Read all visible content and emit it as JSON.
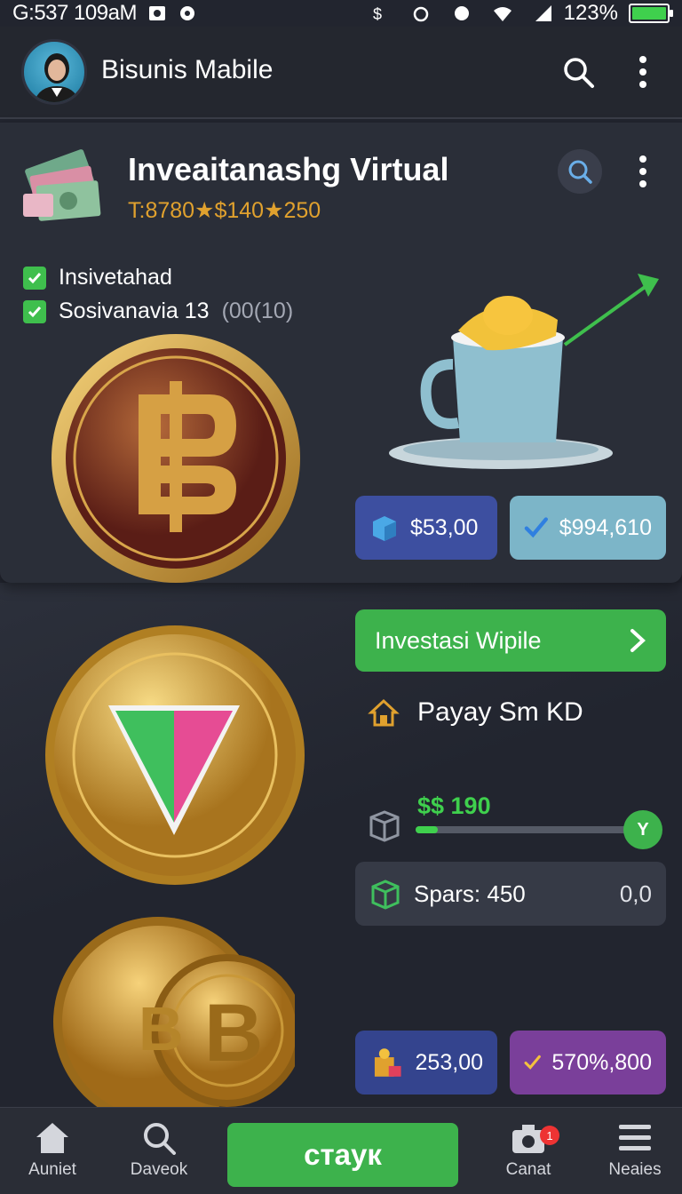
{
  "status_bar": {
    "time": "G:537 109aM",
    "battery": "123%",
    "battery_level": 1.0
  },
  "header": {
    "app_title": "Bisunis Mabile"
  },
  "card": {
    "title": "Inveaitanashg Virtual",
    "subtitle": "T:8780★$140★250",
    "checks": [
      {
        "label": "Insivetahad",
        "checked": true
      },
      {
        "label": "Sosivanavia 13",
        "extra": "(00(10)",
        "checked": true
      }
    ],
    "pill_left": "$53,00",
    "pill_right": "$994,610"
  },
  "right": {
    "invest_button": "Investasi Wipile",
    "payay_label": "Payay Sm KD",
    "price": "$$ 190",
    "slider_level": 0.1,
    "slider_knob": "Y",
    "spars_label": "Spars: 450",
    "spars_value": "0,0"
  },
  "bottom_pills": {
    "left": "253,00",
    "right": "570%,800"
  },
  "nav": {
    "item1": "Auniet",
    "item2": "Daveok",
    "center": "стаук",
    "item4": "Canat",
    "item4_badge": "1",
    "item5": "Neaies"
  },
  "colors": {
    "background": "#22252f",
    "accent_green": "#3db24c",
    "gold": "#e0a12e"
  }
}
